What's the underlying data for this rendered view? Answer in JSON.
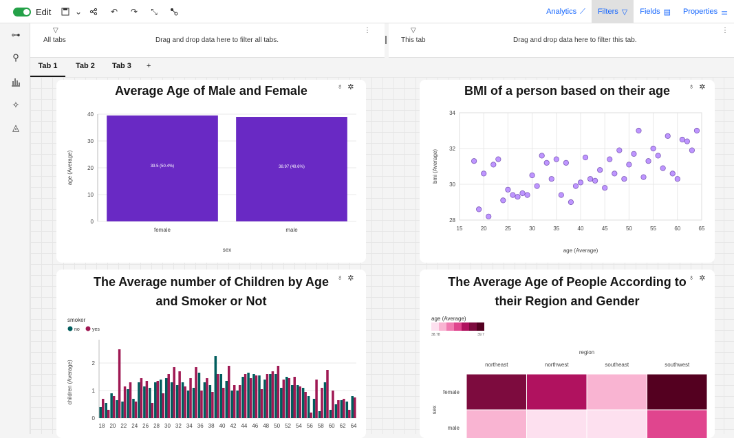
{
  "toolbar": {
    "edit_label": "Edit",
    "analytics": "Analytics",
    "filters": "Filters",
    "fields": "Fields",
    "properties": "Properties"
  },
  "filters": {
    "all_tabs_label": "All tabs",
    "all_tabs_hint": "Drag and drop data here to filter all tabs.",
    "this_tab_label": "This tab",
    "this_tab_hint": "Drag and drop data here to filter this tab."
  },
  "tabs": [
    {
      "label": "Tab 1"
    },
    {
      "label": "Tab 2"
    },
    {
      "label": "Tab 3"
    }
  ],
  "add_tab": "+",
  "colors": {
    "accent": "#0f62fe",
    "bar": "#6929c4",
    "scatter": "#be95ff",
    "no": "#005d5d",
    "yes": "#9f1853"
  },
  "chart_data": [
    {
      "type": "bar",
      "title": "Average Age of Male and Female",
      "categories": [
        "female",
        "male"
      ],
      "values": [
        39.5,
        38.97
      ],
      "value_labels": [
        "39.5 (50.4%)",
        "38.97 (49.6%)"
      ],
      "xlabel": "sex",
      "ylabel": "age (Average)",
      "ylim": [
        0,
        40
      ],
      "yticks": [
        "0",
        "10",
        "20",
        "30",
        "40"
      ]
    },
    {
      "type": "scatter",
      "title": "BMI of a person based on their age",
      "xlabel": "age (Average)",
      "ylabel": "bmi (Average)",
      "xlim": [
        15,
        65
      ],
      "ylim": [
        28,
        34
      ],
      "xticks": [
        "15",
        "20",
        "25",
        "30",
        "35",
        "40",
        "45",
        "50",
        "55",
        "60",
        "65"
      ],
      "yticks": [
        "28",
        "30",
        "32",
        "34"
      ],
      "x": [
        18,
        19,
        20,
        21,
        22,
        23,
        24,
        25,
        26,
        27,
        28,
        29,
        30,
        31,
        32,
        33,
        34,
        35,
        36,
        37,
        38,
        39,
        40,
        41,
        42,
        43,
        44,
        45,
        46,
        47,
        48,
        49,
        50,
        51,
        52,
        53,
        54,
        55,
        56,
        57,
        58,
        59,
        60,
        61,
        62,
        63,
        64
      ],
      "y": [
        31.3,
        28.6,
        30.6,
        28.2,
        31.1,
        31.4,
        29.1,
        29.7,
        29.4,
        29.3,
        29.5,
        29.4,
        30.5,
        29.9,
        31.6,
        31.2,
        30.3,
        31.4,
        29.4,
        31.2,
        29,
        29.9,
        30.1,
        31.5,
        30.3,
        30.2,
        30.8,
        29.8,
        31.4,
        30.6,
        31.9,
        30.3,
        31.1,
        31.7,
        33,
        30.4,
        31.3,
        32,
        31.6,
        30.9,
        32.7,
        30.6,
        30.3,
        32.5,
        32.4,
        31.9,
        33
      ]
    },
    {
      "type": "bar",
      "title": "The Average number of Children by Age and Smoker or Not",
      "legend_title": "smoker",
      "legend": [
        "no",
        "yes"
      ],
      "ylabel": "children (Average)",
      "ylim": [
        0,
        2.6
      ],
      "yticks": [
        "0",
        "1",
        "2"
      ],
      "categories": [
        "18",
        "19",
        "20",
        "21",
        "22",
        "23",
        "24",
        "25",
        "26",
        "27",
        "28",
        "29",
        "30",
        "31",
        "32",
        "33",
        "34",
        "35",
        "36",
        "37",
        "38",
        "39",
        "40",
        "41",
        "42",
        "43",
        "44",
        "45",
        "46",
        "47",
        "48",
        "49",
        "50",
        "51",
        "52",
        "53",
        "54",
        "55",
        "56",
        "57",
        "58",
        "59",
        "60",
        "61",
        "62",
        "63",
        "64"
      ],
      "xticks": [
        "18",
        "20",
        "22",
        "24",
        "26",
        "28",
        "30",
        "32",
        "34",
        "36",
        "38",
        "40",
        "42",
        "44",
        "46",
        "48",
        "50",
        "52",
        "54",
        "56",
        "58",
        "60",
        "62",
        "64"
      ],
      "series": [
        {
          "name": "no",
          "values": [
            0.4,
            0.55,
            0.9,
            0.65,
            0.6,
            1.05,
            0.7,
            1.3,
            1.15,
            1.1,
            1.3,
            1.4,
            1.45,
            1.3,
            1.2,
            1.3,
            1.0,
            1.1,
            1.65,
            1.3,
            1.2,
            2.25,
            1.6,
            1.35,
            1.0,
            1.0,
            1.5,
            1.65,
            1.6,
            1.55,
            1.4,
            1.6,
            1.6,
            1.1,
            1.5,
            1.2,
            1.2,
            1.1,
            0.8,
            0.7,
            0.25,
            1.3,
            0.3,
            0.5,
            0.65,
            0.6,
            0.8
          ]
        },
        {
          "name": "yes",
          "values": [
            0.7,
            0.3,
            0.8,
            2.5,
            1.15,
            1.3,
            0.6,
            1.45,
            1.35,
            0.55,
            1.35,
            0.9,
            1.6,
            1.85,
            1.7,
            1.15,
            1.45,
            1.85,
            1.0,
            1.45,
            0.95,
            1.6,
            1.1,
            1.9,
            1.2,
            1.2,
            1.6,
            1.45,
            1.55,
            1.05,
            1.6,
            1.7,
            1.9,
            1.4,
            1.45,
            1.5,
            1.15,
            0.95,
            0.2,
            1.4,
            1.1,
            1.75,
            1.0,
            0.65,
            0.7,
            0.3,
            0.75
          ]
        }
      ]
    },
    {
      "type": "heatmap",
      "title": "The Average Age of People According to their Region and Gender",
      "legend_title": "age (Average)",
      "legend_min": "38.78",
      "legend_max": "39.7",
      "xlabel": "region",
      "ylabel": "sex",
      "columns": [
        "northeast",
        "northwest",
        "southeast",
        "southwest"
      ],
      "rows": [
        "female",
        "male"
      ],
      "values": [
        [
          39.5,
          39.4,
          38.9,
          39.7
        ],
        [
          38.95,
          38.85,
          38.8,
          39.2
        ]
      ],
      "range": [
        38.78,
        39.7
      ]
    }
  ]
}
